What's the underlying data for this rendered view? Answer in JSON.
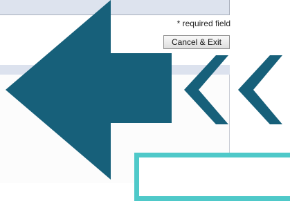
{
  "form": {
    "required_note": "* required field",
    "cancel_label": "Cancel & Exit"
  },
  "overlay": {
    "arrow_color": "#17607a",
    "callout_border_color": "#4fc9c9"
  }
}
